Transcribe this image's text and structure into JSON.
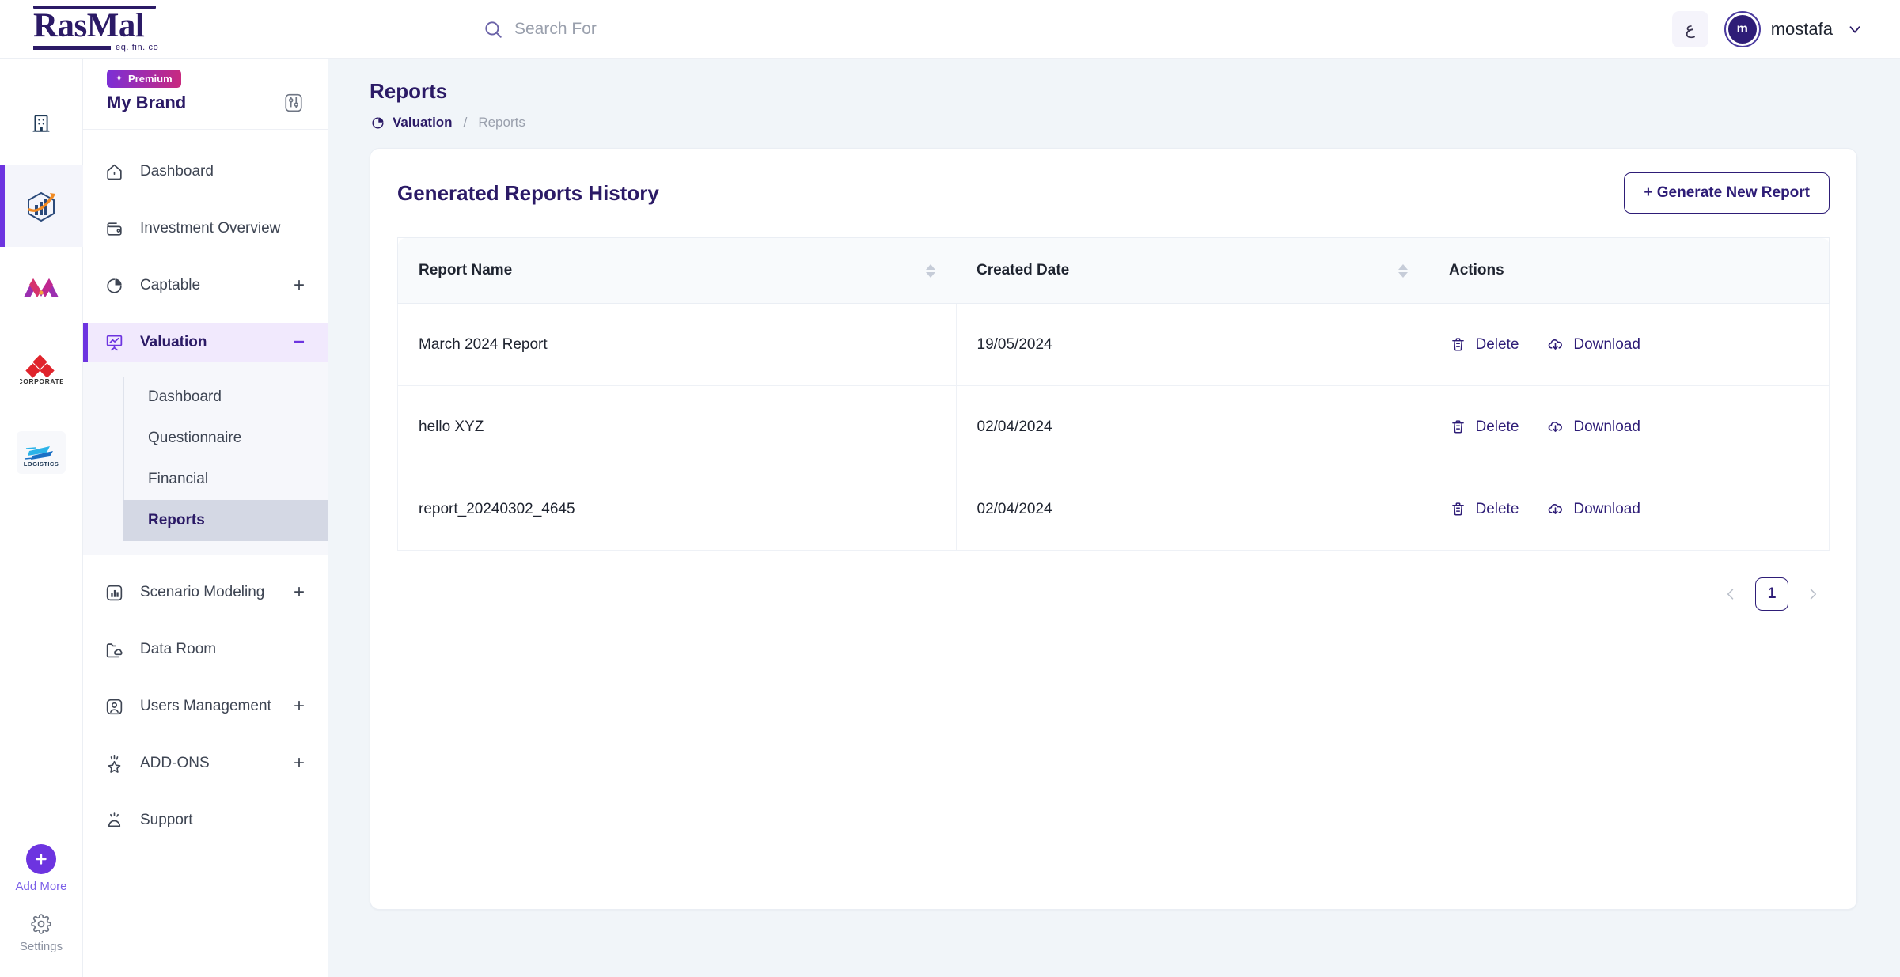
{
  "brand": {
    "logo_text": "RasMal",
    "logo_sub": "eq. fin. co"
  },
  "topbar": {
    "search_placeholder": "Search For",
    "lang_toggle": "ع",
    "avatar_initial": "m",
    "user_name": "mostafa"
  },
  "sidebar": {
    "badge": "Premium",
    "brand_name": "My Brand",
    "items": [
      {
        "label": "Dashboard",
        "icon": "home-icon",
        "toggle": ""
      },
      {
        "label": "Investment Overview",
        "icon": "wallet-icon",
        "toggle": ""
      },
      {
        "label": "Captable",
        "icon": "pie-chart-icon",
        "toggle": "+"
      },
      {
        "label": "Valuation",
        "icon": "presentation-chart-icon",
        "toggle": "−"
      },
      {
        "label": "Scenario Modeling",
        "icon": "bar-chart-box-icon",
        "toggle": "+"
      },
      {
        "label": "Data Room",
        "icon": "folder-cloud-icon",
        "toggle": ""
      },
      {
        "label": "Users Management",
        "icon": "user-box-icon",
        "toggle": "+"
      },
      {
        "label": "ADD-ONS",
        "icon": "star-icon",
        "toggle": "+"
      },
      {
        "label": "Support",
        "icon": "alarm-icon",
        "toggle": ""
      }
    ],
    "submenu": [
      {
        "label": "Dashboard"
      },
      {
        "label": "Questionnaire"
      },
      {
        "label": "Financial"
      },
      {
        "label": "Reports"
      }
    ]
  },
  "rail": {
    "companies": [
      {
        "name": "building-icon"
      },
      {
        "name": "company-logo-hexagon"
      },
      {
        "name": "company-logo-m"
      },
      {
        "name": "company-logo-corporate"
      },
      {
        "name": "company-logo-logistics"
      }
    ],
    "add_more_label": "Add More",
    "settings_label": "Settings"
  },
  "page": {
    "title": "Reports",
    "breadcrumb_parent": "Valuation",
    "breadcrumb_sep": "/",
    "breadcrumb_current": "Reports"
  },
  "card": {
    "title": "Generated Reports History",
    "generate_button": "+ Generate New Report",
    "columns": [
      "Report Name",
      "Created Date",
      "Actions"
    ],
    "rows": [
      {
        "name": "March 2024 Report",
        "date": "19/05/2024",
        "delete": "Delete",
        "download": "Download"
      },
      {
        "name": "hello XYZ",
        "date": "02/04/2024",
        "delete": "Delete",
        "download": "Download"
      },
      {
        "name": "report_20240302_4645",
        "date": "02/04/2024",
        "delete": "Delete",
        "download": "Download"
      }
    ],
    "pagination": {
      "current": "1"
    }
  },
  "colors": {
    "brand_purple": "#2b1a66",
    "accent_purple": "#6d34e0",
    "page_bg": "#f1f5f9",
    "badge_from": "#7b2fd6",
    "badge_to": "#c92a7e"
  }
}
